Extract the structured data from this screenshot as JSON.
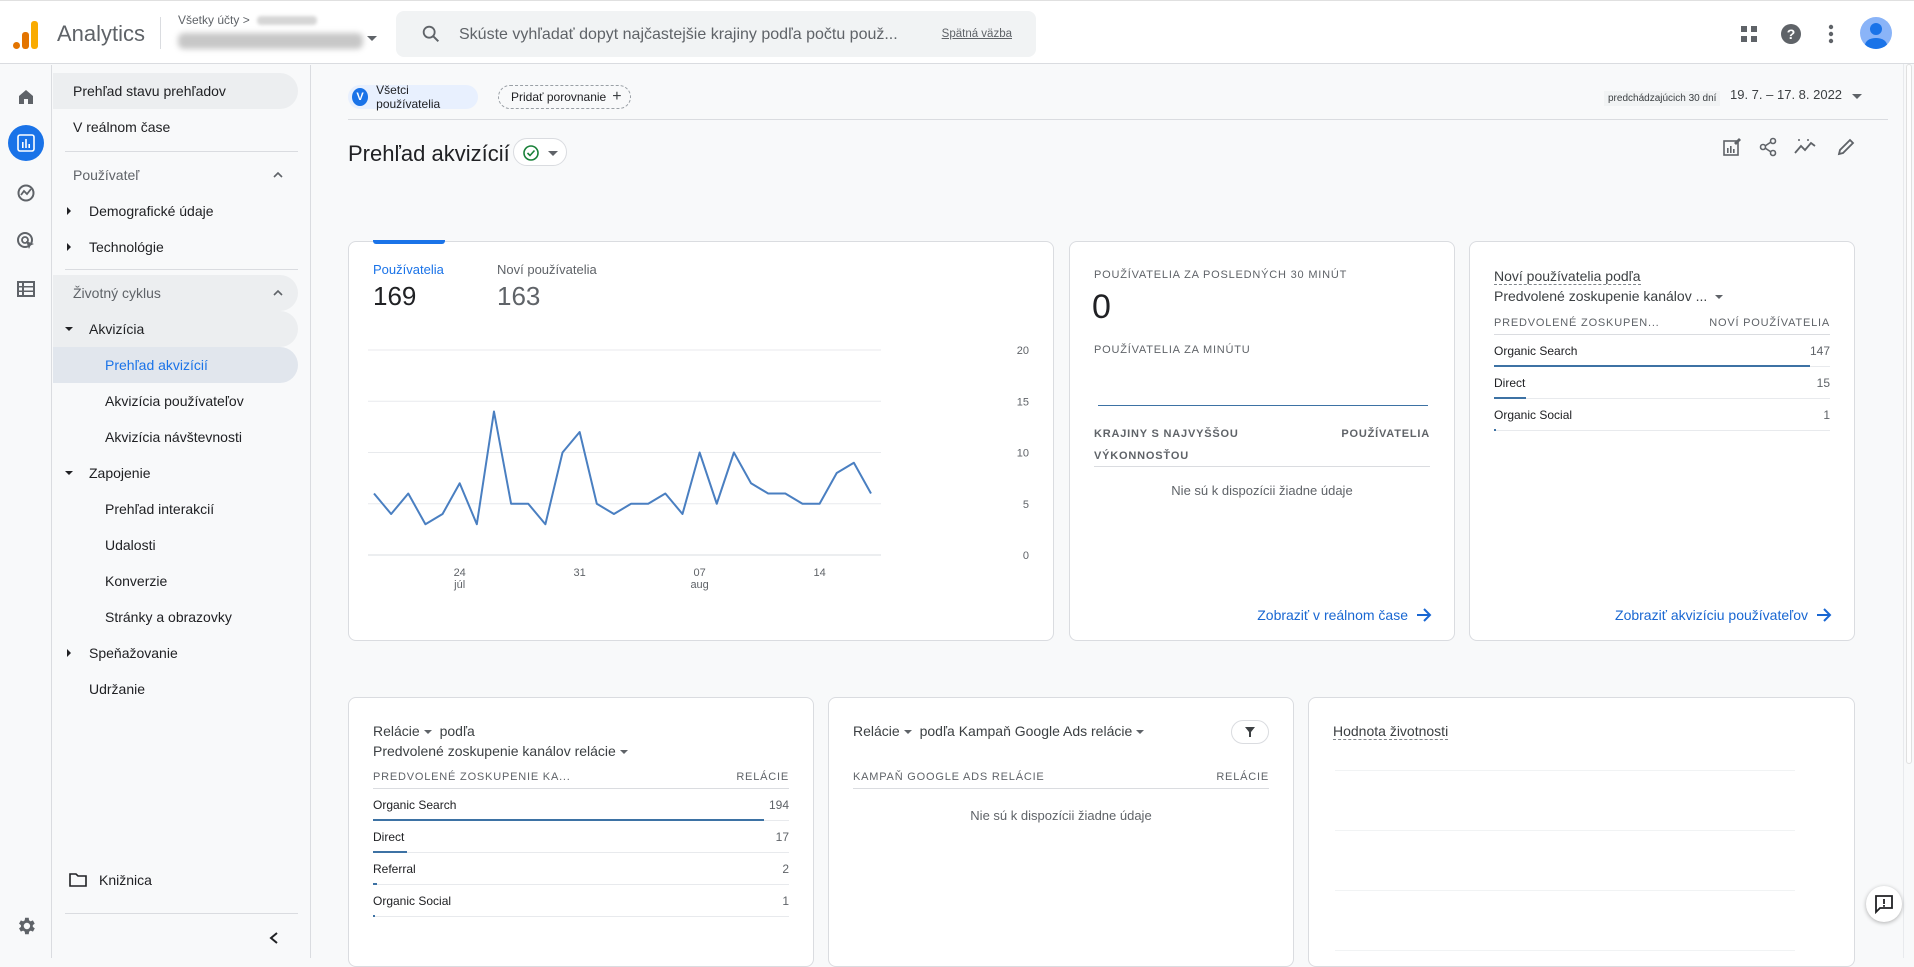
{
  "header": {
    "app_name": "Analytics",
    "breadcrumb_root": "Všetky účty",
    "breadcrumb_sep": ">",
    "search_placeholder": "Skúste vyhľadať dopyt najčastejšie krajiny podľa počtu použ...",
    "feedback_link": "Spätná väzba",
    "icons": [
      "apps-icon",
      "help-icon",
      "more-vert-icon",
      "account-avatar"
    ]
  },
  "rail": {
    "items": [
      "home-icon",
      "reports-icon",
      "explore-icon",
      "advertising-icon",
      "configure-icon"
    ],
    "active": "reports-icon",
    "bottom": "settings-icon"
  },
  "nav": {
    "items": [
      {
        "label": "Prehľad stavu prehľadov"
      },
      {
        "label": "V reálnom čase"
      },
      {
        "label": "Používateľ"
      },
      {
        "label": "Demografické údaje"
      },
      {
        "label": "Technológie"
      },
      {
        "label": "Životný cyklus"
      },
      {
        "label": "Akvizícia"
      },
      {
        "label": "Prehľad akvizícií"
      },
      {
        "label": "Akvizícia používateľov"
      },
      {
        "label": "Akvizícia návštevnosti"
      },
      {
        "label": "Zapojenie"
      },
      {
        "label": "Prehľad interakcií"
      },
      {
        "label": "Udalosti"
      },
      {
        "label": "Konverzie"
      },
      {
        "label": "Stránky a obrazovky"
      },
      {
        "label": "Speňažovanie"
      },
      {
        "label": "Udržanie"
      }
    ],
    "selected": "Prehľad akvizícií",
    "library": "Knižnica"
  },
  "toolbar": {
    "segment_letter": "V",
    "segment_label": "Všetci používatelia",
    "compare_label": "Pridať porovnanie",
    "date_preset": "predchádzajúcich 30 dní",
    "date_range": "19. 7. – 17. 8. 2022",
    "page_title": "Prehľad akvizícií",
    "actions": [
      "customize-report-icon",
      "share-icon",
      "insights-icon",
      "edit-icon"
    ]
  },
  "overview_card": {
    "metrics": [
      {
        "label": "Používatelia",
        "value": "169",
        "active": true
      },
      {
        "label": "Noví používatelia",
        "value": "163",
        "active": false
      }
    ]
  },
  "chart_data": {
    "type": "line",
    "title": "",
    "xlabel": "",
    "ylabel": "",
    "series": [
      {
        "name": "Používatelia",
        "color": "#4a7fc1",
        "values": [
          6,
          4,
          6,
          3,
          4,
          7,
          3,
          14,
          5,
          5,
          3,
          10,
          12,
          5,
          4,
          5,
          5,
          6,
          4,
          10,
          5,
          10,
          7,
          6,
          6,
          5,
          5,
          8,
          9,
          6
        ]
      }
    ],
    "x_start_day_index_note": "daily points 19.7.–17.8.",
    "x_ticks": [
      {
        "index": 5,
        "label": "24",
        "sub": "júl"
      },
      {
        "index": 12,
        "label": "31",
        "sub": ""
      },
      {
        "index": 19,
        "label": "07",
        "sub": "aug"
      },
      {
        "index": 26,
        "label": "14",
        "sub": ""
      }
    ],
    "y_ticks": [
      0,
      5,
      10,
      15,
      20
    ],
    "ylim": [
      0,
      20
    ],
    "grid": true
  },
  "realtime_card": {
    "title": "Používatelia za posledných 30 minút",
    "value": "0",
    "per_minute_label": "Používatelia za minútu",
    "col1": "Krajiny s najvyššou výkonnosťou",
    "col2": "Používatelia",
    "empty": "Nie sú k dispozícii žiadne údaje",
    "link": "Zobraziť v reálnom čase"
  },
  "new_users_card": {
    "title_line1": "Noví používatelia podľa",
    "title_line2": "Predvolené zoskupenie kanálov ...",
    "col1": "Predvolené zoskupen...",
    "col2": "Noví používatelia",
    "rows": [
      {
        "name": "Organic Search",
        "value": 147
      },
      {
        "name": "Direct",
        "value": 15
      },
      {
        "name": "Organic Social",
        "value": 1
      }
    ],
    "link": "Zobraziť akvizíciu používateľov"
  },
  "sessions_card": {
    "metric": "Relácie",
    "by": "podľa",
    "dimension": "Predvolené zoskupenie kanálov relácie",
    "col1": "Predvolené zoskupenie ka...",
    "col2": "Relácie",
    "rows": [
      {
        "name": "Organic Search",
        "value": 194
      },
      {
        "name": "Direct",
        "value": 17
      },
      {
        "name": "Referral",
        "value": 2
      },
      {
        "name": "Organic Social",
        "value": 1
      }
    ]
  },
  "ads_card": {
    "metric": "Relácie",
    "dimension": "podľa Kampaň Google Ads relácie",
    "col1": "Kampaň Google Ads relácie",
    "col2": "Relácie",
    "empty": "Nie sú k dispozícii žiadne údaje"
  },
  "ltv_card": {
    "title": "Hodnota životnosti"
  },
  "colors": {
    "accent": "#1a73e8",
    "line": "#4a7fc1",
    "bar": "#3d72a4",
    "logo_orange": "#f9ab00",
    "logo_dark": "#e37400"
  }
}
